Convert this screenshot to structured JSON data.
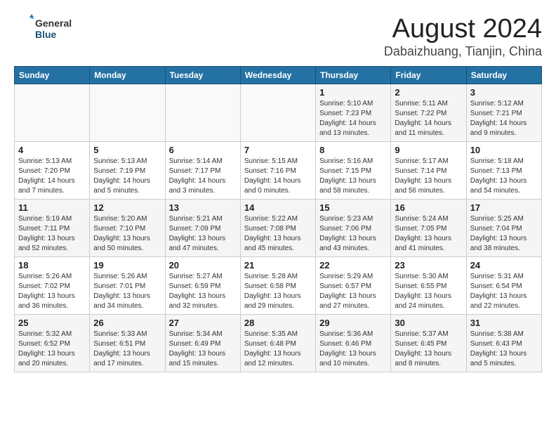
{
  "logo": {
    "general": "General",
    "blue": "Blue"
  },
  "title": "August 2024",
  "location": "Dabaizhuang, Tianjin, China",
  "days_of_week": [
    "Sunday",
    "Monday",
    "Tuesday",
    "Wednesday",
    "Thursday",
    "Friday",
    "Saturday"
  ],
  "weeks": [
    [
      {
        "day": "",
        "info": ""
      },
      {
        "day": "",
        "info": ""
      },
      {
        "day": "",
        "info": ""
      },
      {
        "day": "",
        "info": ""
      },
      {
        "day": "1",
        "info": "Sunrise: 5:10 AM\nSunset: 7:23 PM\nDaylight: 14 hours\nand 13 minutes."
      },
      {
        "day": "2",
        "info": "Sunrise: 5:11 AM\nSunset: 7:22 PM\nDaylight: 14 hours\nand 11 minutes."
      },
      {
        "day": "3",
        "info": "Sunrise: 5:12 AM\nSunset: 7:21 PM\nDaylight: 14 hours\nand 9 minutes."
      }
    ],
    [
      {
        "day": "4",
        "info": "Sunrise: 5:13 AM\nSunset: 7:20 PM\nDaylight: 14 hours\nand 7 minutes."
      },
      {
        "day": "5",
        "info": "Sunrise: 5:13 AM\nSunset: 7:19 PM\nDaylight: 14 hours\nand 5 minutes."
      },
      {
        "day": "6",
        "info": "Sunrise: 5:14 AM\nSunset: 7:17 PM\nDaylight: 14 hours\nand 3 minutes."
      },
      {
        "day": "7",
        "info": "Sunrise: 5:15 AM\nSunset: 7:16 PM\nDaylight: 14 hours\nand 0 minutes."
      },
      {
        "day": "8",
        "info": "Sunrise: 5:16 AM\nSunset: 7:15 PM\nDaylight: 13 hours\nand 58 minutes."
      },
      {
        "day": "9",
        "info": "Sunrise: 5:17 AM\nSunset: 7:14 PM\nDaylight: 13 hours\nand 56 minutes."
      },
      {
        "day": "10",
        "info": "Sunrise: 5:18 AM\nSunset: 7:13 PM\nDaylight: 13 hours\nand 54 minutes."
      }
    ],
    [
      {
        "day": "11",
        "info": "Sunrise: 5:19 AM\nSunset: 7:11 PM\nDaylight: 13 hours\nand 52 minutes."
      },
      {
        "day": "12",
        "info": "Sunrise: 5:20 AM\nSunset: 7:10 PM\nDaylight: 13 hours\nand 50 minutes."
      },
      {
        "day": "13",
        "info": "Sunrise: 5:21 AM\nSunset: 7:09 PM\nDaylight: 13 hours\nand 47 minutes."
      },
      {
        "day": "14",
        "info": "Sunrise: 5:22 AM\nSunset: 7:08 PM\nDaylight: 13 hours\nand 45 minutes."
      },
      {
        "day": "15",
        "info": "Sunrise: 5:23 AM\nSunset: 7:06 PM\nDaylight: 13 hours\nand 43 minutes."
      },
      {
        "day": "16",
        "info": "Sunrise: 5:24 AM\nSunset: 7:05 PM\nDaylight: 13 hours\nand 41 minutes."
      },
      {
        "day": "17",
        "info": "Sunrise: 5:25 AM\nSunset: 7:04 PM\nDaylight: 13 hours\nand 38 minutes."
      }
    ],
    [
      {
        "day": "18",
        "info": "Sunrise: 5:26 AM\nSunset: 7:02 PM\nDaylight: 13 hours\nand 36 minutes."
      },
      {
        "day": "19",
        "info": "Sunrise: 5:26 AM\nSunset: 7:01 PM\nDaylight: 13 hours\nand 34 minutes."
      },
      {
        "day": "20",
        "info": "Sunrise: 5:27 AM\nSunset: 6:59 PM\nDaylight: 13 hours\nand 32 minutes."
      },
      {
        "day": "21",
        "info": "Sunrise: 5:28 AM\nSunset: 6:58 PM\nDaylight: 13 hours\nand 29 minutes."
      },
      {
        "day": "22",
        "info": "Sunrise: 5:29 AM\nSunset: 6:57 PM\nDaylight: 13 hours\nand 27 minutes."
      },
      {
        "day": "23",
        "info": "Sunrise: 5:30 AM\nSunset: 6:55 PM\nDaylight: 13 hours\nand 24 minutes."
      },
      {
        "day": "24",
        "info": "Sunrise: 5:31 AM\nSunset: 6:54 PM\nDaylight: 13 hours\nand 22 minutes."
      }
    ],
    [
      {
        "day": "25",
        "info": "Sunrise: 5:32 AM\nSunset: 6:52 PM\nDaylight: 13 hours\nand 20 minutes."
      },
      {
        "day": "26",
        "info": "Sunrise: 5:33 AM\nSunset: 6:51 PM\nDaylight: 13 hours\nand 17 minutes."
      },
      {
        "day": "27",
        "info": "Sunrise: 5:34 AM\nSunset: 6:49 PM\nDaylight: 13 hours\nand 15 minutes."
      },
      {
        "day": "28",
        "info": "Sunrise: 5:35 AM\nSunset: 6:48 PM\nDaylight: 13 hours\nand 12 minutes."
      },
      {
        "day": "29",
        "info": "Sunrise: 5:36 AM\nSunset: 6:46 PM\nDaylight: 13 hours\nand 10 minutes."
      },
      {
        "day": "30",
        "info": "Sunrise: 5:37 AM\nSunset: 6:45 PM\nDaylight: 13 hours\nand 8 minutes."
      },
      {
        "day": "31",
        "info": "Sunrise: 5:38 AM\nSunset: 6:43 PM\nDaylight: 13 hours\nand 5 minutes."
      }
    ]
  ]
}
